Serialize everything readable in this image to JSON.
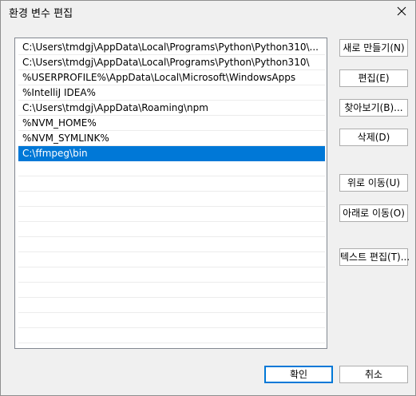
{
  "dialog": {
    "title": "환경 변수 편집"
  },
  "paths": [
    "C:\\Users\\tmdgj\\AppData\\Local\\Programs\\Python\\Python310\\...",
    "C:\\Users\\tmdgj\\AppData\\Local\\Programs\\Python\\Python310\\",
    "%USERPROFILE%\\AppData\\Local\\Microsoft\\WindowsApps",
    "%IntelliJ IDEA%",
    "C:\\Users\\tmdgj\\AppData\\Roaming\\npm",
    "%NVM_HOME%",
    "%NVM_SYMLINK%",
    "C:\\ffmpeg\\bin"
  ],
  "selected_path": "C:\\ffmpeg\\bin",
  "buttons": {
    "new": "새로 만들기(N)",
    "edit": "편집(E)",
    "browse": "찾아보기(B)...",
    "delete": "삭제(D)",
    "move_up": "위로 이동(U)",
    "move_down": "아래로 이동(O)",
    "edit_text": "텍스트 편집(T)...",
    "ok": "확인",
    "cancel": "취소"
  },
  "colors": {
    "selection": "#0078d7",
    "window_bg": "#f0f0f0"
  }
}
